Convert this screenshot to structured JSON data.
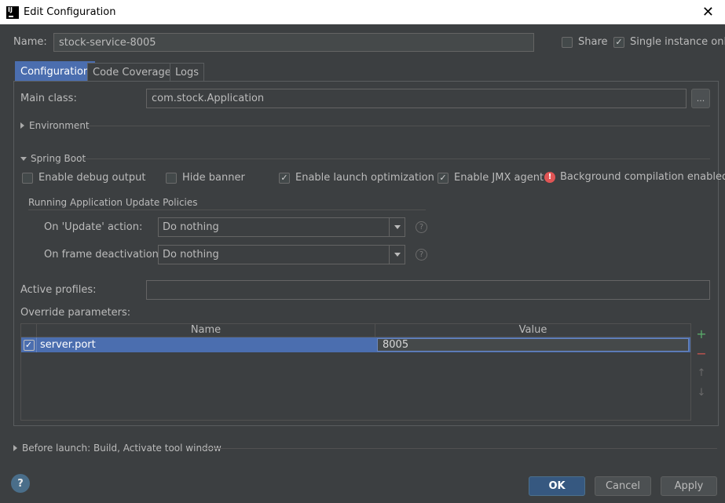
{
  "window": {
    "title": "Edit Configuration",
    "close_glyph": "✕",
    "icon": "intellij-icon",
    "icon_letters": "IJ"
  },
  "name_row": {
    "label": "Name:",
    "value": "stock-service-8005",
    "share": {
      "label": "Share",
      "checked": false
    },
    "single_instance": {
      "label": "Single instance only",
      "checked": true
    }
  },
  "tabs": [
    {
      "label": "Configuration",
      "active": true
    },
    {
      "label": "Code Coverage",
      "active": false
    },
    {
      "label": "Logs",
      "active": false
    }
  ],
  "main_class": {
    "label": "Main class:",
    "value": "com.stock.Application",
    "browse_label": "..."
  },
  "environment": {
    "label": "Environment",
    "expanded": false
  },
  "spring_boot": {
    "label": "Spring Boot",
    "expanded": true,
    "options": {
      "debug_output": {
        "label": "Enable debug output",
        "checked": false
      },
      "hide_banner": {
        "label": "Hide banner",
        "checked": false
      },
      "launch_optimization": {
        "label": "Enable launch optimization",
        "checked": true
      },
      "jmx_agent": {
        "label": "Enable JMX agent",
        "checked": true
      }
    },
    "background_compilation": {
      "text": "Background compilation enabled",
      "icon": "error-icon",
      "icon_color": "#e05555"
    }
  },
  "update_policies": {
    "title": "Running Application Update Policies",
    "on_update": {
      "label": "On 'Update' action:",
      "value": "Do nothing"
    },
    "on_frame_deactivation": {
      "label": "On frame deactivation:",
      "value": "Do nothing"
    },
    "help_glyph": "?"
  },
  "active_profiles": {
    "label": "Active profiles:",
    "value": ""
  },
  "override_parameters": {
    "label": "Override parameters:",
    "columns": [
      "Name",
      "Value"
    ],
    "rows": [
      {
        "checked": true,
        "name": "server.port",
        "value": "8005"
      }
    ],
    "side_buttons": {
      "add": "+",
      "remove": "−",
      "up": "↑",
      "down": "↓"
    }
  },
  "before_launch": {
    "label": "Before launch: Build, Activate tool window",
    "expanded": false
  },
  "footer": {
    "help": "?",
    "ok": "OK",
    "cancel": "Cancel",
    "apply": "Apply"
  },
  "colors": {
    "accent": "#4b6eaf",
    "background": "#3c3f41",
    "add_green": "#59a869",
    "remove_red": "#c75450"
  }
}
